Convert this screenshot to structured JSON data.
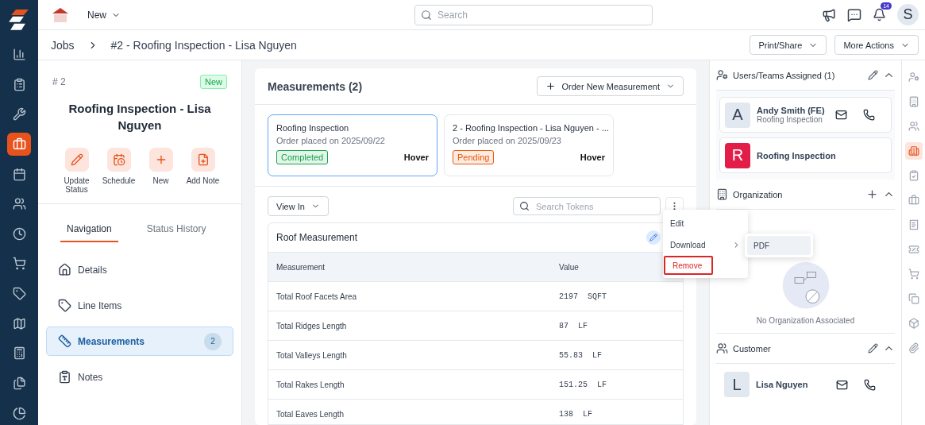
{
  "app_rail": {
    "items": [
      {
        "kind": "chart",
        "selected": false
      },
      {
        "kind": "tasks",
        "selected": false
      },
      {
        "kind": "tools",
        "selected": false
      },
      {
        "kind": "jobs",
        "selected": true
      },
      {
        "kind": "calendar",
        "selected": false
      },
      {
        "kind": "people",
        "selected": false
      },
      {
        "kind": "clock",
        "selected": false
      },
      {
        "kind": "cart",
        "selected": false
      },
      {
        "kind": "tag",
        "selected": false
      },
      {
        "kind": "map",
        "selected": false
      },
      {
        "kind": "calculator",
        "selected": false
      },
      {
        "kind": "files",
        "selected": false
      },
      {
        "kind": "pie",
        "selected": false
      }
    ]
  },
  "header": {
    "menu_button": "New",
    "search": {
      "placeholder": "Search"
    },
    "notification_count": "14",
    "avatar": "S"
  },
  "breadcrumb": {
    "items": [
      "Jobs",
      "#2 - Roofing Inspection - Lisa Nguyen"
    ],
    "buttons": [
      "Print/Share",
      "More Actions"
    ]
  },
  "job": {
    "number": "# 2",
    "status": "New",
    "title": "Roofing Inspection - Lisa Nguyen",
    "actions": [
      {
        "label": "Update Status",
        "kind": "edit"
      },
      {
        "label": "Schedule",
        "kind": "schedule"
      },
      {
        "label": "New",
        "kind": "add"
      },
      {
        "label": "Add Note",
        "kind": "note"
      }
    ],
    "tabs": [
      {
        "label": "Navigation",
        "selected": true
      },
      {
        "label": "Status History",
        "selected": false
      }
    ],
    "nav_items": [
      {
        "label": "Details",
        "kind": "home",
        "selected": false
      },
      {
        "label": "Line Items",
        "kind": "tag",
        "selected": false
      },
      {
        "label": "Measurements",
        "kind": "ruler",
        "selected": true,
        "count": "2"
      },
      {
        "label": "Notes",
        "kind": "notes",
        "selected": false
      }
    ]
  },
  "measurements": {
    "title": "Measurements (2)",
    "order_button": "Order New Measurement",
    "orders": [
      {
        "title": "Roofing Inspection",
        "date": "Order placed on 2025/09/22",
        "status": "Completed",
        "color": "#16a34a",
        "provider": "Hover",
        "selected": true
      },
      {
        "title": "2 - Roofing Inspection - Lisa Nguyen - ...",
        "date": "Order placed on 2025/09/23",
        "status": "Pending",
        "color": "#ea580c",
        "provider": "Hover",
        "selected": false
      }
    ],
    "view_button": "View In",
    "search": {
      "placeholder": "Search Tokens"
    },
    "table": {
      "title": "Roof Measurement",
      "columns": [
        "Measurement",
        "Value"
      ],
      "rows": [
        [
          "Total Roof Facets Area",
          "2197  SQFT"
        ],
        [
          "Total Ridges Length",
          "87  LF"
        ],
        [
          "Total Valleys Length",
          "55.83  LF"
        ],
        [
          "Total Rakes Length",
          "151.25  LF"
        ],
        [
          "Total Eaves Length",
          "138  LF"
        ]
      ]
    },
    "menu": {
      "items": [
        {
          "label": "Edit",
          "submenu": false,
          "highlighted": false
        },
        {
          "label": "Download",
          "submenu": true,
          "highlighted": false
        },
        {
          "label": "Remove",
          "submenu": false,
          "highlighted": true
        }
      ],
      "submenu": [
        "PDF"
      ]
    }
  },
  "side_panel": {
    "assigned": {
      "title": "Users/Teams Assigned (1)",
      "members": [
        {
          "initial": "A",
          "name": "Andy Smith (FE)",
          "role": "Roofing Inspection",
          "kind": "user"
        },
        {
          "initial": "R",
          "name": "Roofing Inspection",
          "kind": "team"
        }
      ]
    },
    "organization": {
      "title": "Organization",
      "empty": "No Organization Associated"
    },
    "customer": {
      "title": "Customer",
      "initial": "L",
      "name": "Lisa Nguyen"
    }
  },
  "right_rail": {
    "items": [
      {
        "kind": "user",
        "selected": false
      },
      {
        "kind": "building",
        "selected": false
      },
      {
        "kind": "users",
        "selected": false
      },
      {
        "kind": "company",
        "selected": true
      },
      {
        "kind": "clipboard",
        "selected": false
      },
      {
        "kind": "briefcase",
        "selected": false
      },
      {
        "kind": "receipt",
        "selected": false
      },
      {
        "kind": "discount",
        "selected": false
      },
      {
        "kind": "cart",
        "selected": false
      },
      {
        "kind": "copy",
        "selected": false
      },
      {
        "kind": "box",
        "selected": false
      },
      {
        "kind": "paperclip",
        "selected": false
      }
    ]
  }
}
